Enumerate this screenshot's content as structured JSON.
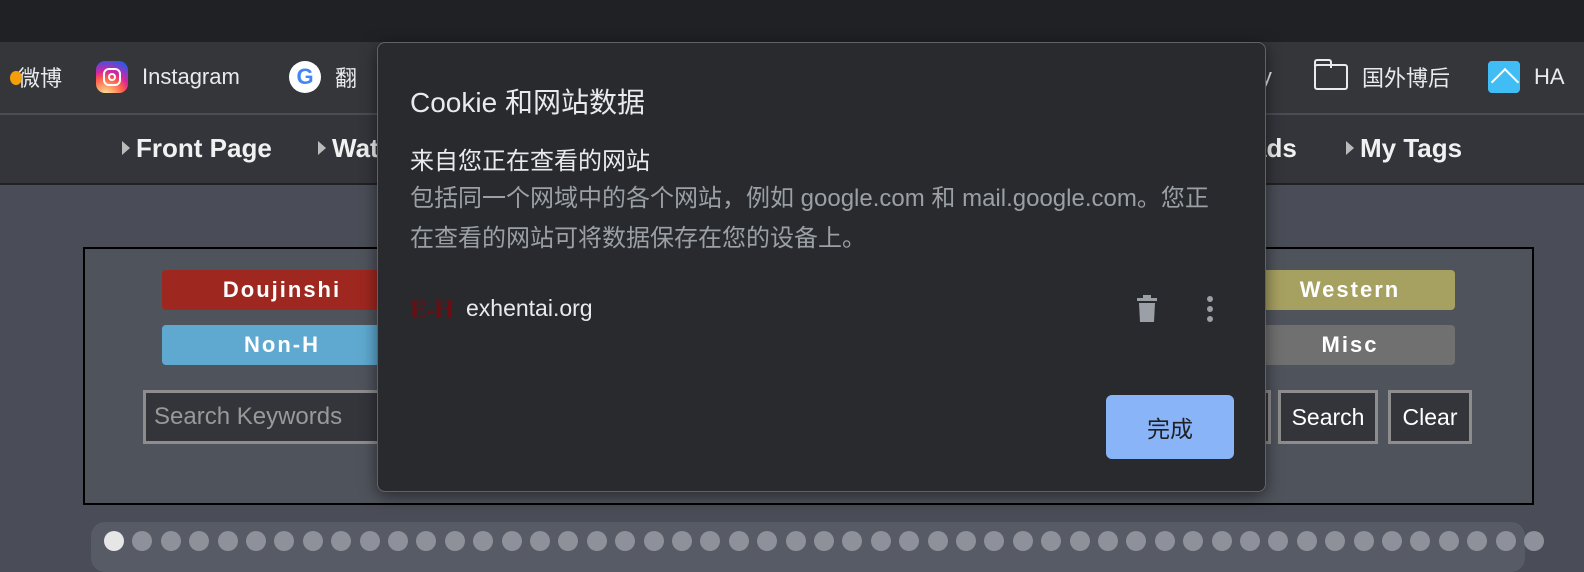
{
  "bookmarks": {
    "weibo": "微博",
    "instagram": "Instagram",
    "google_translate": "翻",
    "partial_right": "ly",
    "folder_label": "国外博后",
    "ha_label": "HA"
  },
  "nav": {
    "front_page": "Front Page",
    "watched": "Wat",
    "torrents_partial": "ads",
    "my_tags": "My Tags"
  },
  "categories": {
    "doujinshi": "Doujinshi",
    "non_h": "Non-H",
    "western": "Western",
    "misc": "Misc",
    "colors": {
      "doujinshi": "#9e2720",
      "non_h": "#5fa9d0",
      "western": "#a6a061",
      "misc": "#707070"
    }
  },
  "search": {
    "placeholder": "Search Keywords",
    "search_button": "Search",
    "clear_button": "Clear"
  },
  "dialog": {
    "title": "Cookie 和网站数据",
    "subtitle": "来自您正在查看的网站",
    "description": "包括同一个网域中的各个网站，例如 google.com 和 mail.google.com。您正在查看的网站可将数据保存在您的设备上。",
    "site_logo": "E-H",
    "site_name": "exhentai.org",
    "done_button": "完成",
    "accent_color": "#8ab4f8"
  }
}
